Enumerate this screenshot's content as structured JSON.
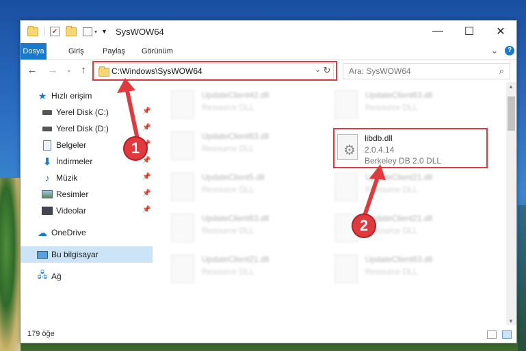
{
  "window": {
    "title": "SysWOW64",
    "minimize_glyph": "—",
    "maximize_glyph": "☐",
    "close_glyph": "✕"
  },
  "ribbon": {
    "tabs": [
      "Dosya",
      "Giriş",
      "Paylaş",
      "Görünüm"
    ],
    "active_tab": "Dosya",
    "collapse_glyph": "⌄",
    "help_glyph": "?"
  },
  "nav": {
    "back_glyph": "←",
    "forward_glyph": "→",
    "recent_glyph": "⌄",
    "up_glyph": "↑",
    "address": "C:\\Windows\\SysWOW64",
    "address_dropdown_glyph": "⌄",
    "refresh_glyph": "↻",
    "search_placeholder": "Ara: SysWOW64",
    "search_glyph": "⌕"
  },
  "sidebar": {
    "items": [
      {
        "label": "Hızlı erişim",
        "icon": "star-icon",
        "pinned": false
      },
      {
        "label": "Yerel Disk (C:)",
        "icon": "drive-icon",
        "pinned": true
      },
      {
        "label": "Yerel Disk (D:)",
        "icon": "drive-icon",
        "pinned": true
      },
      {
        "label": "Belgeler",
        "icon": "document-icon",
        "pinned": true
      },
      {
        "label": "İndirmeler",
        "icon": "download-icon",
        "pinned": true
      },
      {
        "label": "Müzik",
        "icon": "music-icon",
        "pinned": true
      },
      {
        "label": "Resimler",
        "icon": "pictures-icon",
        "pinned": true
      },
      {
        "label": "Videolar",
        "icon": "video-icon",
        "pinned": true
      },
      {
        "label": "OneDrive",
        "icon": "cloud-icon",
        "pinned": false
      },
      {
        "label": "Bu bilgisayar",
        "icon": "computer-icon",
        "pinned": false
      },
      {
        "label": "Ağ",
        "icon": "network-icon",
        "pinned": false
      }
    ],
    "selected": "Bu bilgisayar",
    "pin_glyph": "📌"
  },
  "files": [
    {
      "name": "UpdateClient42.dll",
      "type": "Resource DLL"
    },
    {
      "name": "UpdateClient63.dll",
      "type": "Resource DLL"
    },
    {
      "name": "UpdateClient63.dll",
      "type": "Resource DLL"
    },
    {
      "name": "UpdateClient5.dll",
      "type": "Resource DLL"
    },
    {
      "name": "UpdateClient21.dll",
      "type": "Resource DLL"
    },
    {
      "name": "UpdateClient63.dll",
      "type": "Resource DLL"
    },
    {
      "name": "UpdateClient21.dll",
      "type": "Resource DLL"
    },
    {
      "name": "UpdateClient21.dll",
      "type": "Resource DLL"
    },
    {
      "name": "UpdateClient63.dll",
      "type": "Resource DLL"
    }
  ],
  "highlighted_file": {
    "name": "libdb.dll",
    "version": "2.0.4.14",
    "description": "Berkeley DB 2.0 DLL"
  },
  "status": {
    "item_count": "179 öğe"
  },
  "callouts": [
    "1",
    "2"
  ],
  "colors": {
    "accent": "#1979ca",
    "highlight": "#e0393e",
    "selected_bg": "#cce4f7"
  }
}
